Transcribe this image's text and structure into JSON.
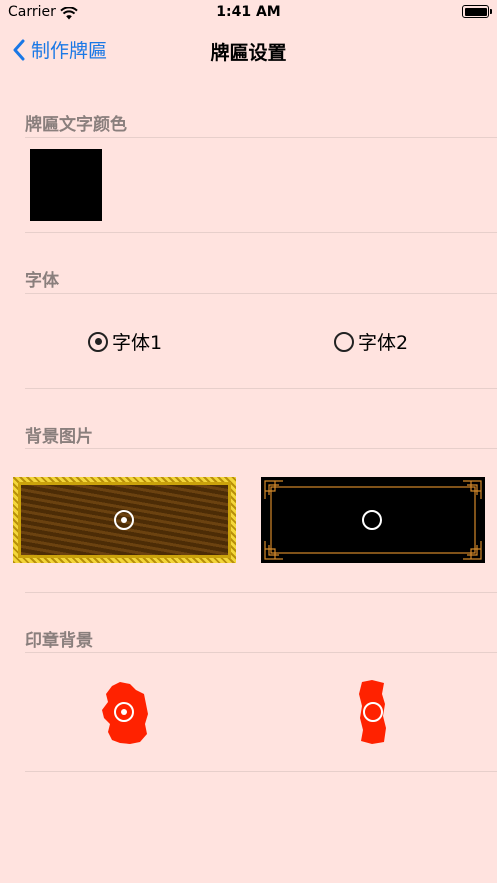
{
  "status": {
    "carrier": "Carrier",
    "time": "1:41 AM"
  },
  "nav": {
    "back_label": "制作牌匾",
    "title": "牌匾设置"
  },
  "sections": {
    "text_color": {
      "title": "牌匾文字颜色",
      "selected_color": "#000000"
    },
    "font": {
      "title": "字体",
      "options": [
        "字体1",
        "字体2"
      ],
      "selected": 0
    },
    "background": {
      "title": "背景图片",
      "selected": 0
    },
    "seal": {
      "title": "印章背景",
      "selected": 0
    }
  },
  "colors": {
    "page_bg": "#ffe3df",
    "accent": "#1a78e6",
    "seal_red": "#ff2200"
  },
  "icons": [
    "wifi-icon",
    "battery-icon",
    "chevron-left-icon",
    "radio-icon"
  ]
}
